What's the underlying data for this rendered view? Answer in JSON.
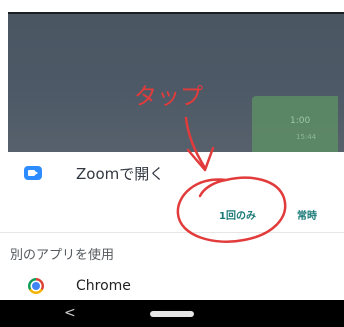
{
  "background_chat": {
    "bubble_text": "1:00",
    "bubble_sub": "15:44"
  },
  "sheet": {
    "open_with_app": "Zoomで開く",
    "buttons": {
      "once": "1回のみ",
      "always": "常時"
    },
    "other_apps_label": "別のアプリを使用",
    "other_apps": [
      {
        "name": "Chrome",
        "icon": "chrome-icon"
      }
    ]
  },
  "annotation": {
    "text": "タップ",
    "color": "#e23b3b"
  },
  "navbar": {
    "back_glyph": "<"
  },
  "colors": {
    "accent": "#1a7a78",
    "zoom_blue": "#2d8cff",
    "chat_background": "#4d5966"
  }
}
